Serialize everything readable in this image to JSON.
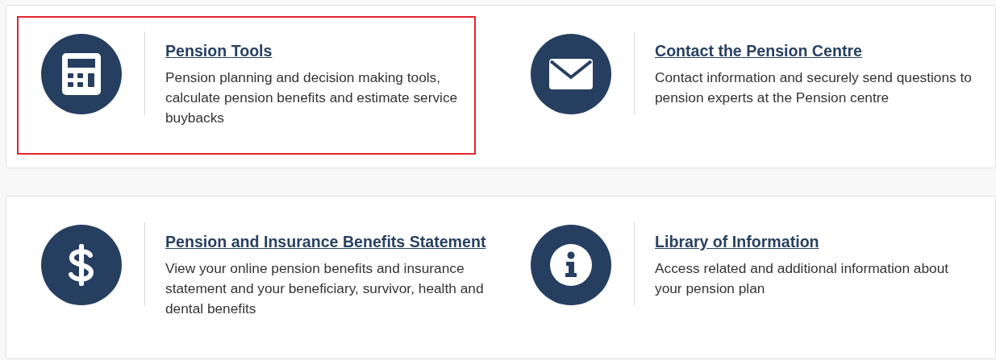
{
  "cards": [
    {
      "tiles": [
        {
          "kind": "calculator",
          "title": "Pension Tools",
          "description": "Pension planning and decision making tools, calculate pension benefits and estimate service buybacks",
          "highlighted": true
        },
        {
          "kind": "envelope",
          "title": "Contact the Pension Centre",
          "description": "Contact information and securely send questions to pension experts at the Pension centre",
          "highlighted": false
        }
      ]
    },
    {
      "tiles": [
        {
          "kind": "dollar",
          "title": "Pension and Insurance Benefits Statement",
          "description": "View your online pension benefits and insurance statement and your beneficiary, survivor, health and dental benefits",
          "highlighted": false
        },
        {
          "kind": "info",
          "title": "Library of Information",
          "description": "Access related and additional information about your pension plan",
          "highlighted": false
        }
      ]
    }
  ]
}
